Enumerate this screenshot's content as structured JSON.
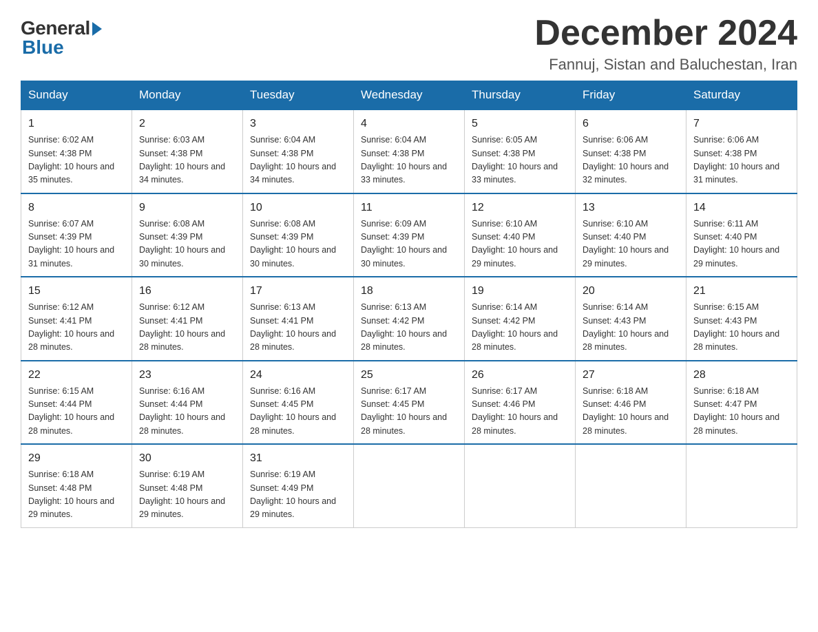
{
  "logo": {
    "general": "General",
    "blue": "Blue"
  },
  "title": {
    "month_year": "December 2024",
    "location": "Fannuj, Sistan and Baluchestan, Iran"
  },
  "headers": [
    "Sunday",
    "Monday",
    "Tuesday",
    "Wednesday",
    "Thursday",
    "Friday",
    "Saturday"
  ],
  "weeks": [
    [
      {
        "day": "1",
        "sunrise": "6:02 AM",
        "sunset": "4:38 PM",
        "daylight": "10 hours and 35 minutes."
      },
      {
        "day": "2",
        "sunrise": "6:03 AM",
        "sunset": "4:38 PM",
        "daylight": "10 hours and 34 minutes."
      },
      {
        "day": "3",
        "sunrise": "6:04 AM",
        "sunset": "4:38 PM",
        "daylight": "10 hours and 34 minutes."
      },
      {
        "day": "4",
        "sunrise": "6:04 AM",
        "sunset": "4:38 PM",
        "daylight": "10 hours and 33 minutes."
      },
      {
        "day": "5",
        "sunrise": "6:05 AM",
        "sunset": "4:38 PM",
        "daylight": "10 hours and 33 minutes."
      },
      {
        "day": "6",
        "sunrise": "6:06 AM",
        "sunset": "4:38 PM",
        "daylight": "10 hours and 32 minutes."
      },
      {
        "day": "7",
        "sunrise": "6:06 AM",
        "sunset": "4:38 PM",
        "daylight": "10 hours and 31 minutes."
      }
    ],
    [
      {
        "day": "8",
        "sunrise": "6:07 AM",
        "sunset": "4:39 PM",
        "daylight": "10 hours and 31 minutes."
      },
      {
        "day": "9",
        "sunrise": "6:08 AM",
        "sunset": "4:39 PM",
        "daylight": "10 hours and 30 minutes."
      },
      {
        "day": "10",
        "sunrise": "6:08 AM",
        "sunset": "4:39 PM",
        "daylight": "10 hours and 30 minutes."
      },
      {
        "day": "11",
        "sunrise": "6:09 AM",
        "sunset": "4:39 PM",
        "daylight": "10 hours and 30 minutes."
      },
      {
        "day": "12",
        "sunrise": "6:10 AM",
        "sunset": "4:40 PM",
        "daylight": "10 hours and 29 minutes."
      },
      {
        "day": "13",
        "sunrise": "6:10 AM",
        "sunset": "4:40 PM",
        "daylight": "10 hours and 29 minutes."
      },
      {
        "day": "14",
        "sunrise": "6:11 AM",
        "sunset": "4:40 PM",
        "daylight": "10 hours and 29 minutes."
      }
    ],
    [
      {
        "day": "15",
        "sunrise": "6:12 AM",
        "sunset": "4:41 PM",
        "daylight": "10 hours and 28 minutes."
      },
      {
        "day": "16",
        "sunrise": "6:12 AM",
        "sunset": "4:41 PM",
        "daylight": "10 hours and 28 minutes."
      },
      {
        "day": "17",
        "sunrise": "6:13 AM",
        "sunset": "4:41 PM",
        "daylight": "10 hours and 28 minutes."
      },
      {
        "day": "18",
        "sunrise": "6:13 AM",
        "sunset": "4:42 PM",
        "daylight": "10 hours and 28 minutes."
      },
      {
        "day": "19",
        "sunrise": "6:14 AM",
        "sunset": "4:42 PM",
        "daylight": "10 hours and 28 minutes."
      },
      {
        "day": "20",
        "sunrise": "6:14 AM",
        "sunset": "4:43 PM",
        "daylight": "10 hours and 28 minutes."
      },
      {
        "day": "21",
        "sunrise": "6:15 AM",
        "sunset": "4:43 PM",
        "daylight": "10 hours and 28 minutes."
      }
    ],
    [
      {
        "day": "22",
        "sunrise": "6:15 AM",
        "sunset": "4:44 PM",
        "daylight": "10 hours and 28 minutes."
      },
      {
        "day": "23",
        "sunrise": "6:16 AM",
        "sunset": "4:44 PM",
        "daylight": "10 hours and 28 minutes."
      },
      {
        "day": "24",
        "sunrise": "6:16 AM",
        "sunset": "4:45 PM",
        "daylight": "10 hours and 28 minutes."
      },
      {
        "day": "25",
        "sunrise": "6:17 AM",
        "sunset": "4:45 PM",
        "daylight": "10 hours and 28 minutes."
      },
      {
        "day": "26",
        "sunrise": "6:17 AM",
        "sunset": "4:46 PM",
        "daylight": "10 hours and 28 minutes."
      },
      {
        "day": "27",
        "sunrise": "6:18 AM",
        "sunset": "4:46 PM",
        "daylight": "10 hours and 28 minutes."
      },
      {
        "day": "28",
        "sunrise": "6:18 AM",
        "sunset": "4:47 PM",
        "daylight": "10 hours and 28 minutes."
      }
    ],
    [
      {
        "day": "29",
        "sunrise": "6:18 AM",
        "sunset": "4:48 PM",
        "daylight": "10 hours and 29 minutes."
      },
      {
        "day": "30",
        "sunrise": "6:19 AM",
        "sunset": "4:48 PM",
        "daylight": "10 hours and 29 minutes."
      },
      {
        "day": "31",
        "sunrise": "6:19 AM",
        "sunset": "4:49 PM",
        "daylight": "10 hours and 29 minutes."
      },
      null,
      null,
      null,
      null
    ]
  ]
}
